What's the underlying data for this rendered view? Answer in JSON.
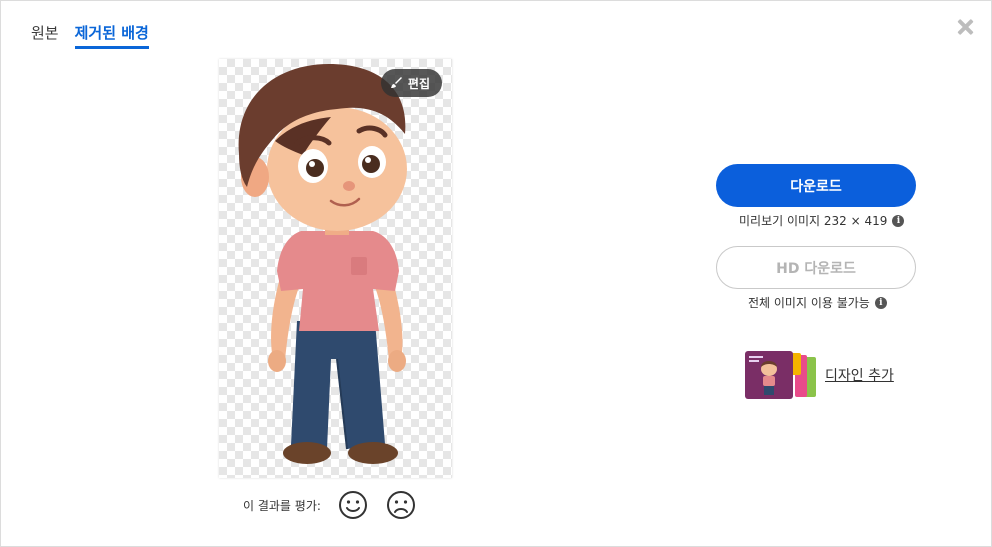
{
  "tabs": [
    {
      "label": "원본",
      "active": false
    },
    {
      "label": "제거된 배경",
      "active": true
    }
  ],
  "preview": {
    "edit_label": "편집"
  },
  "rating": {
    "label": "이 결과를 평가:",
    "positive_icon": "smile-icon",
    "negative_icon": "frown-icon"
  },
  "download": {
    "button_label": "다운로드",
    "preview_info": "미리보기 이미지 232 × 419"
  },
  "hd_download": {
    "button_label": "HD 다운로드",
    "info": "전체 이미지 이용 불가능"
  },
  "design": {
    "link_label": "디자인 추가"
  },
  "colors": {
    "accent": "#0b5fdc",
    "tab_active": "#0a66d8",
    "disabled_text": "#b4b4b4"
  }
}
